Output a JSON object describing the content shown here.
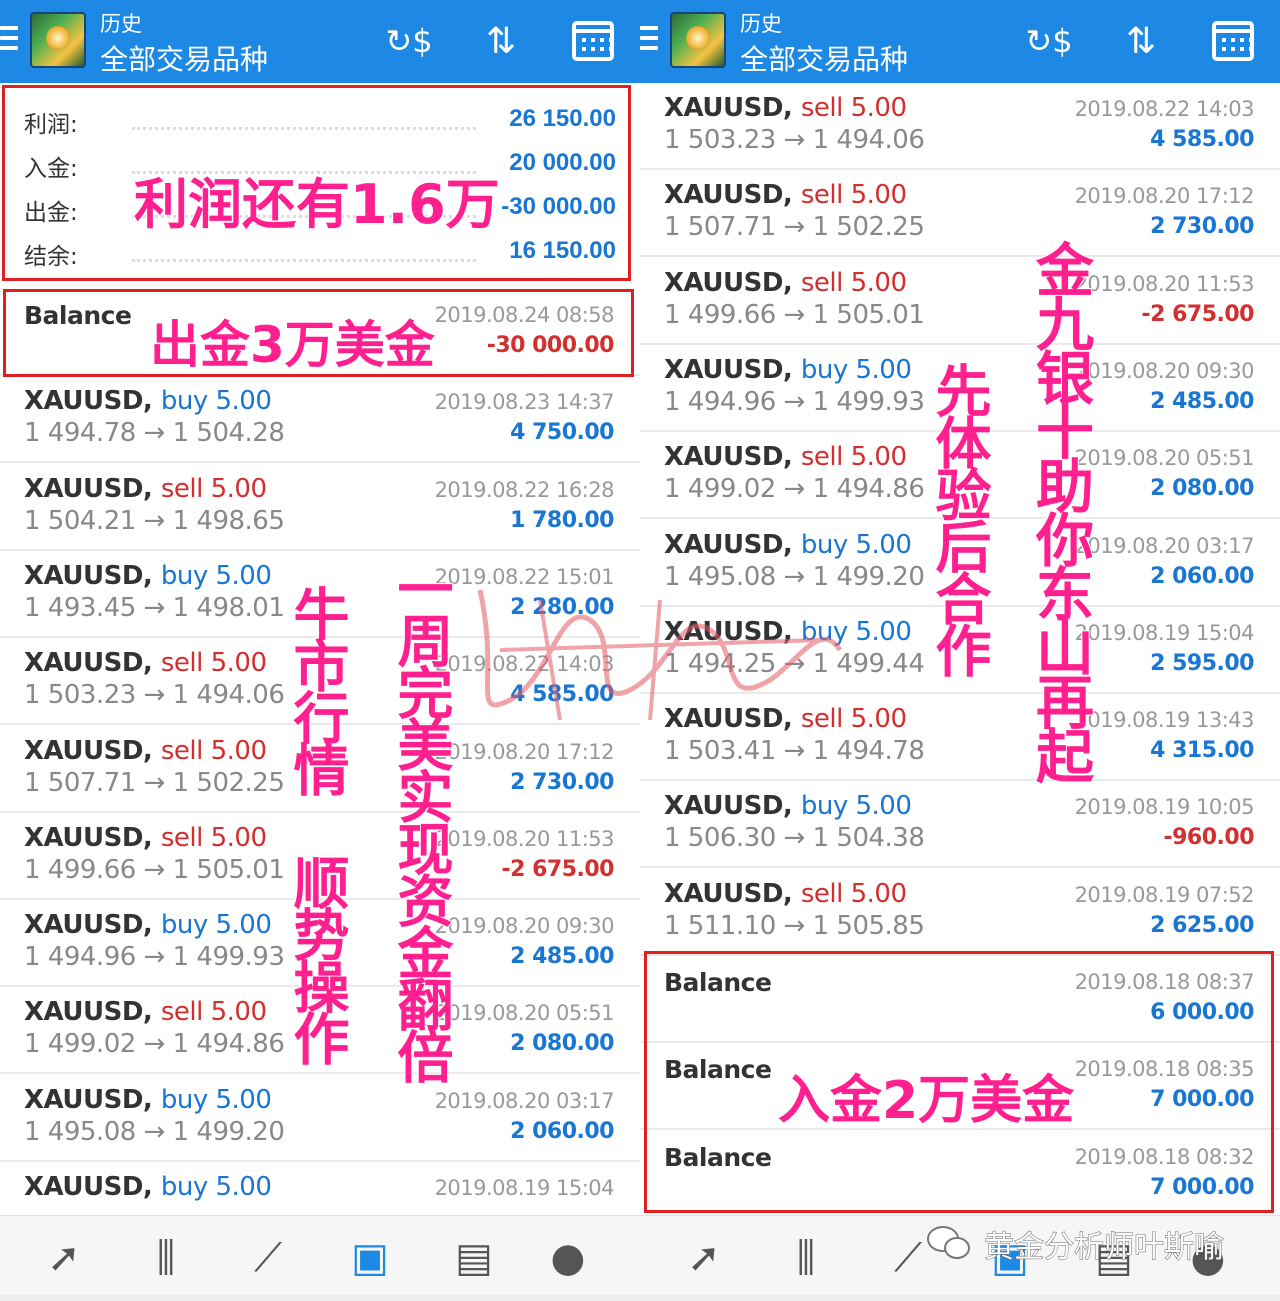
{
  "appbar": {
    "subtitle": "历史",
    "title": "全部交易品种"
  },
  "summary": [
    {
      "label": "利润:",
      "value": "26 150.00"
    },
    {
      "label": "入金:",
      "value": "20 000.00"
    },
    {
      "label": "出金:",
      "value": "-30 000.00"
    },
    {
      "label": "结余:",
      "value": "16 150.00"
    }
  ],
  "left_rows": [
    {
      "type": "balance",
      "label": "Balance",
      "time": "2019.08.24 08:58",
      "profit": "-30 000.00",
      "sign": "neg"
    },
    {
      "type": "trade",
      "symbol": "XAUUSD,",
      "side": "buy",
      "volume": "5.00",
      "prices": "1 494.78 → 1 504.28",
      "time": "2019.08.23 14:37",
      "profit": "4 750.00",
      "sign": "pos"
    },
    {
      "type": "trade",
      "symbol": "XAUUSD,",
      "side": "sell",
      "volume": "5.00",
      "prices": "1 504.21 → 1 498.65",
      "time": "2019.08.22 16:28",
      "profit": "1 780.00",
      "sign": "pos"
    },
    {
      "type": "trade",
      "symbol": "XAUUSD,",
      "side": "buy",
      "volume": "5.00",
      "prices": "1 493.45 → 1 498.01",
      "time": "2019.08.22 15:01",
      "profit": "2 280.00",
      "sign": "pos"
    },
    {
      "type": "trade",
      "symbol": "XAUUSD,",
      "side": "sell",
      "volume": "5.00",
      "prices": "1 503.23 → 1 494.06",
      "time": "2019.08.22 14:03",
      "profit": "4 585.00",
      "sign": "pos"
    },
    {
      "type": "trade",
      "symbol": "XAUUSD,",
      "side": "sell",
      "volume": "5.00",
      "prices": "1 507.71 → 1 502.25",
      "time": "2019.08.20 17:12",
      "profit": "2 730.00",
      "sign": "pos"
    },
    {
      "type": "trade",
      "symbol": "XAUUSD,",
      "side": "sell",
      "volume": "5.00",
      "prices": "1 499.66 → 1 505.01",
      "time": "2019.08.20 11:53",
      "profit": "-2 675.00",
      "sign": "neg"
    },
    {
      "type": "trade",
      "symbol": "XAUUSD,",
      "side": "buy",
      "volume": "5.00",
      "prices": "1 494.96 → 1 499.93",
      "time": "2019.08.20 09:30",
      "profit": "2 485.00",
      "sign": "pos"
    },
    {
      "type": "trade",
      "symbol": "XAUUSD,",
      "side": "sell",
      "volume": "5.00",
      "prices": "1 499.02 → 1 494.86",
      "time": "2019.08.20 05:51",
      "profit": "2 080.00",
      "sign": "pos"
    },
    {
      "type": "trade",
      "symbol": "XAUUSD,",
      "side": "buy",
      "volume": "5.00",
      "prices": "1 495.08 → 1 499.20",
      "time": "2019.08.20 03:17",
      "profit": "2 060.00",
      "sign": "pos"
    },
    {
      "type": "trade",
      "symbol": "XAUUSD,",
      "side": "buy",
      "volume": "5.00",
      "prices": "",
      "time": "2019.08.19 15:04",
      "profit": "",
      "sign": "pos"
    }
  ],
  "right_rows": [
    {
      "type": "trade",
      "symbol": "XAUUSD,",
      "side": "sell",
      "volume": "5.00",
      "prices": "1 503.23 → 1 494.06",
      "time": "2019.08.22 14:03",
      "profit": "4 585.00",
      "sign": "pos"
    },
    {
      "type": "trade",
      "symbol": "XAUUSD,",
      "side": "sell",
      "volume": "5.00",
      "prices": "1 507.71 → 1 502.25",
      "time": "2019.08.20 17:12",
      "profit": "2 730.00",
      "sign": "pos"
    },
    {
      "type": "trade",
      "symbol": "XAUUSD,",
      "side": "sell",
      "volume": "5.00",
      "prices": "1 499.66 → 1 505.01",
      "time": "2019.08.20 11:53",
      "profit": "-2 675.00",
      "sign": "neg"
    },
    {
      "type": "trade",
      "symbol": "XAUUSD,",
      "side": "buy",
      "volume": "5.00",
      "prices": "1 494.96 → 1 499.93",
      "time": "2019.08.20 09:30",
      "profit": "2 485.00",
      "sign": "pos"
    },
    {
      "type": "trade",
      "symbol": "XAUUSD,",
      "side": "sell",
      "volume": "5.00",
      "prices": "1 499.02 → 1 494.86",
      "time": "2019.08.20 05:51",
      "profit": "2 080.00",
      "sign": "pos"
    },
    {
      "type": "trade",
      "symbol": "XAUUSD,",
      "side": "buy",
      "volume": "5.00",
      "prices": "1 495.08 → 1 499.20",
      "time": "2019.08.20 03:17",
      "profit": "2 060.00",
      "sign": "pos"
    },
    {
      "type": "trade",
      "symbol": "XAUUSD,",
      "side": "buy",
      "volume": "5.00",
      "prices": "1 494.25 → 1 499.44",
      "time": "2019.08.19 15:04",
      "profit": "2 595.00",
      "sign": "pos"
    },
    {
      "type": "trade",
      "symbol": "XAUUSD,",
      "side": "sell",
      "volume": "5.00",
      "prices": "1 503.41 → 1 494.78",
      "time": "2019.08.19 13:43",
      "profit": "4 315.00",
      "sign": "pos"
    },
    {
      "type": "trade",
      "symbol": "XAUUSD,",
      "side": "buy",
      "volume": "5.00",
      "prices": "1 506.30 → 1 504.38",
      "time": "2019.08.19 10:05",
      "profit": "-960.00",
      "sign": "neg"
    },
    {
      "type": "trade",
      "symbol": "XAUUSD,",
      "side": "sell",
      "volume": "5.00",
      "prices": "1 511.10 → 1 505.85",
      "time": "2019.08.19 07:52",
      "profit": "2 625.00",
      "sign": "pos"
    },
    {
      "type": "balance",
      "label": "Balance",
      "time": "2019.08.18 08:37",
      "profit": "6 000.00",
      "sign": "pos"
    },
    {
      "type": "balance",
      "label": "Balance",
      "time": "2019.08.18 08:35",
      "profit": "7 000.00",
      "sign": "pos"
    },
    {
      "type": "balance",
      "label": "Balance",
      "time": "2019.08.18 08:32",
      "profit": "7 000.00",
      "sign": "pos"
    }
  ],
  "overlays": {
    "profit_note": "利润还有1.6万",
    "withdraw_note": "出金3万美金",
    "bull_note": "牛市行情 顺势操作",
    "week_note": "一周完美实现资金翻倍",
    "try_note": "先体验后合作",
    "help_note": "金九银十助你东山再起",
    "deposit_note": "入金2万美金"
  },
  "watermark": "黄金分析师叶斯喻",
  "colors": {
    "appbar": "#1e88e5",
    "buy": "#1976d2",
    "sell": "#d32f2f",
    "overlay": "#ff1f8f",
    "box": "#e02020"
  },
  "bottom_nav": [
    "trade-icon",
    "chart-candles-icon",
    "chart-trend-icon",
    "history-inbox-icon",
    "news-icon",
    "chat-icon"
  ]
}
